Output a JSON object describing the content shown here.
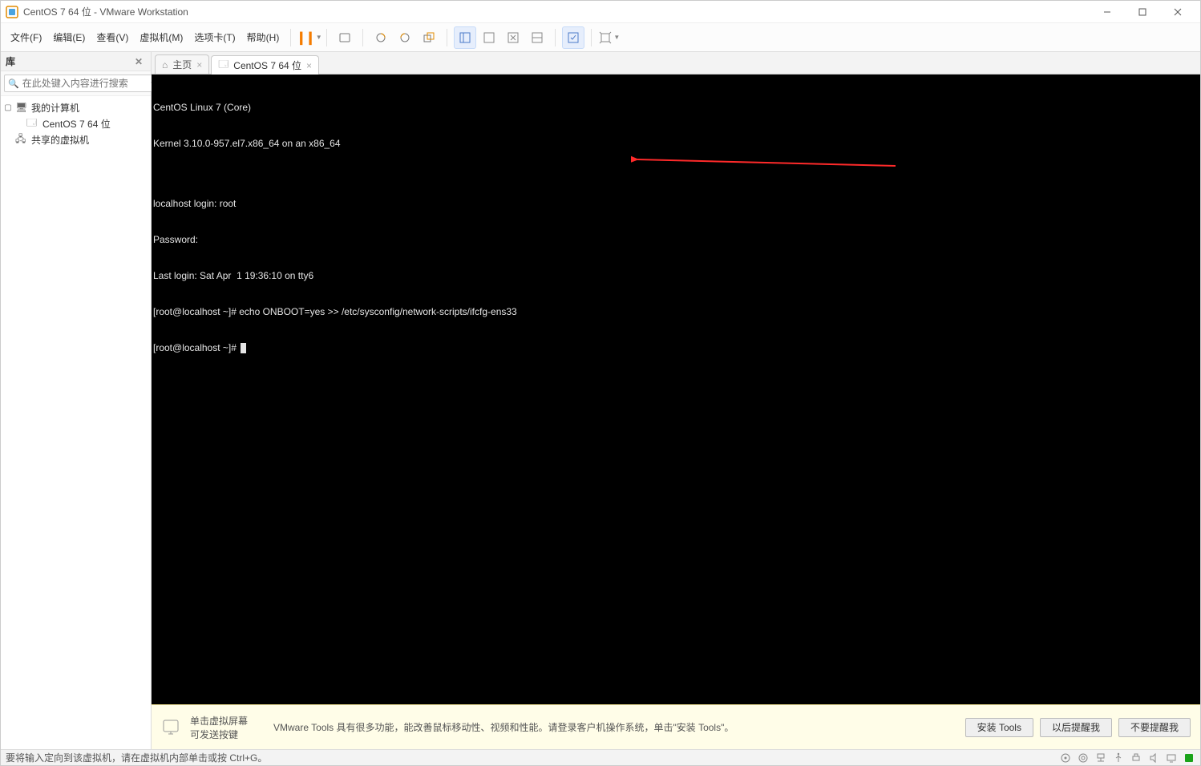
{
  "window": {
    "title": "CentOS 7 64 位 - VMware Workstation"
  },
  "menus": {
    "file": "文件(F)",
    "edit": "编辑(E)",
    "view": "查看(V)",
    "vm": "虚拟机(M)",
    "tabs": "选项卡(T)",
    "help": "帮助(H)"
  },
  "sidebar": {
    "title": "库",
    "search_placeholder": "在此处键入内容进行搜索",
    "root_label": "我的计算机",
    "vm_label": "CentOS 7 64 位",
    "shared_label": "共享的虚拟机"
  },
  "tabs": {
    "home": "主页",
    "vm": "CentOS 7 64 位"
  },
  "terminal": {
    "lines": [
      "CentOS Linux 7 (Core)",
      "Kernel 3.10.0-957.el7.x86_64 on an x86_64",
      "",
      "localhost login: root",
      "Password:",
      "Last login: Sat Apr  1 19:36:10 on tty6",
      "[root@localhost ~]# echo ONBOOT=yes >> /etc/sysconfig/network-scripts/ifcfg-ens33",
      "[root@localhost ~]# "
    ]
  },
  "footer": {
    "hint_line1": "单击虚拟屏幕",
    "hint_line2": "可发送按键",
    "tools_msg": "VMware Tools 具有很多功能，能改善鼠标移动性、视频和性能。请登录客户机操作系统，单击\"安装 Tools\"。",
    "btn_install": "安装 Tools",
    "btn_later": "以后提醒我",
    "btn_never": "不要提醒我"
  },
  "status": {
    "text": "要将输入定向到该虚拟机，请在虚拟机内部单击或按 Ctrl+G。"
  }
}
